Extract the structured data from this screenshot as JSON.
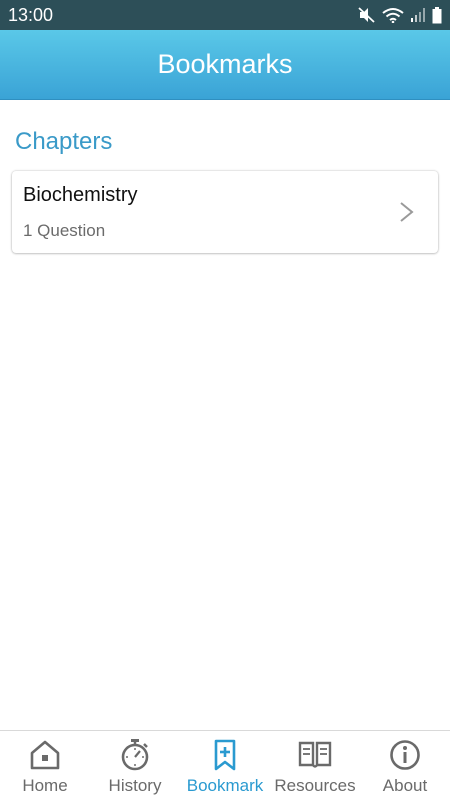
{
  "status_bar": {
    "time": "13:00",
    "icons": [
      "mute-icon",
      "wifi-icon",
      "signal-icon",
      "battery-icon"
    ]
  },
  "app_bar": {
    "title": "Bookmarks"
  },
  "section": {
    "title": "Chapters"
  },
  "chapters": [
    {
      "name": "Biochemistry",
      "count": "1 Question",
      "icon": "chevron-right-icon"
    }
  ],
  "bottom_nav": {
    "active": "Bookmark",
    "items": [
      {
        "label": "Home",
        "icon": "home-icon"
      },
      {
        "label": "History",
        "icon": "stopwatch-icon"
      },
      {
        "label": "Bookmark",
        "icon": "bookmark-plus-icon"
      },
      {
        "label": "Resources",
        "icon": "open-book-icon"
      },
      {
        "label": "About",
        "icon": "info-icon"
      }
    ]
  },
  "colors": {
    "status_bar": "#2d4f58",
    "app_bar": "#44b3e0",
    "accent": "#2a9ad0",
    "section_title": "#3a9ac8",
    "inactive": "#6a6a6a"
  }
}
